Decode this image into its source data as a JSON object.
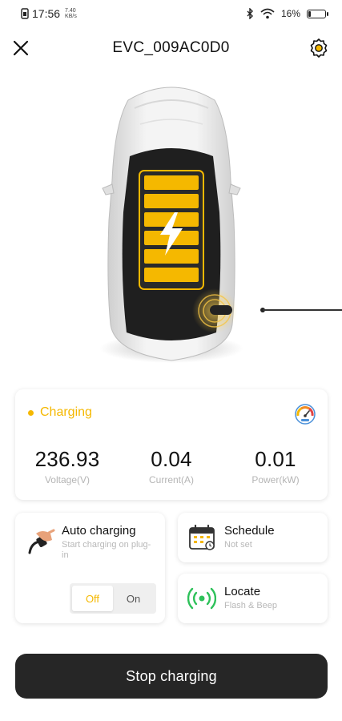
{
  "statusbar": {
    "time": "17:56",
    "net_speed_value": "7.40",
    "net_speed_unit": "KB/s",
    "battery_percent": "16%",
    "battery_level": 0.16
  },
  "header": {
    "title": "EVC_009AC0D0"
  },
  "status": {
    "text": "Charging",
    "color": "#f5b800"
  },
  "metrics": [
    {
      "value": "236.93",
      "label": "Voltage(V)"
    },
    {
      "value": "0.04",
      "label": "Current(A)"
    },
    {
      "value": "0.01",
      "label": "Power(kW)"
    }
  ],
  "auto_charging": {
    "title": "Auto charging",
    "subtitle": "Start charging on plug-in",
    "off_label": "Off",
    "on_label": "On",
    "selected": "Off"
  },
  "schedule": {
    "title": "Schedule",
    "subtitle": "Not set"
  },
  "locate": {
    "title": "Locate",
    "subtitle": "Flash & Beep"
  },
  "actions": {
    "stop_label": "Stop charging"
  },
  "icons": {
    "close": "close-icon",
    "settings": "gear-icon",
    "gauge": "gauge-icon",
    "plug": "plug-icon",
    "calendar": "calendar-icon",
    "signal": "signal-icon"
  },
  "colors": {
    "accent": "#f5b800",
    "button": "#262626",
    "locate_green": "#2ec15a"
  }
}
